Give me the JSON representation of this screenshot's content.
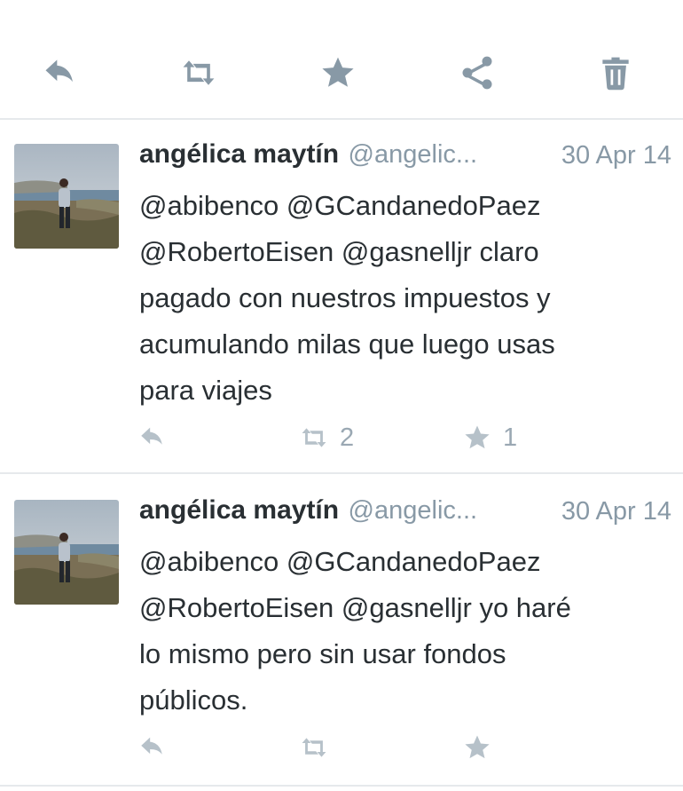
{
  "toolbar": {
    "icons": [
      "reply-icon",
      "retweet-icon",
      "favorite-icon",
      "share-icon",
      "delete-icon"
    ]
  },
  "tweets": [
    {
      "name": "angélica maytín",
      "handle": "@angelic...",
      "date": "30 Apr 14",
      "lines": [
        "@abibenco @GCandanedoPaez",
        "@RobertoEisen @gasnelljr claro",
        "pagado con nuestros impuestos y",
        "acumulando milas que luego usas",
        "para viajes"
      ],
      "retweets": "2",
      "favorites": "1"
    },
    {
      "name": "angélica maytín",
      "handle": "@angelic...",
      "date": "30 Apr 14",
      "lines": [
        "@abibenco @GCandanedoPaez",
        "@RobertoEisen @gasnelljr yo haré",
        "lo mismo pero sin usar fondos",
        "públicos."
      ],
      "retweets": "",
      "favorites": ""
    }
  ],
  "colors": {
    "icon": "#8899a6",
    "action_icon": "#b6c1c9",
    "text": "#292f33",
    "divider": "#e6e9ec"
  }
}
